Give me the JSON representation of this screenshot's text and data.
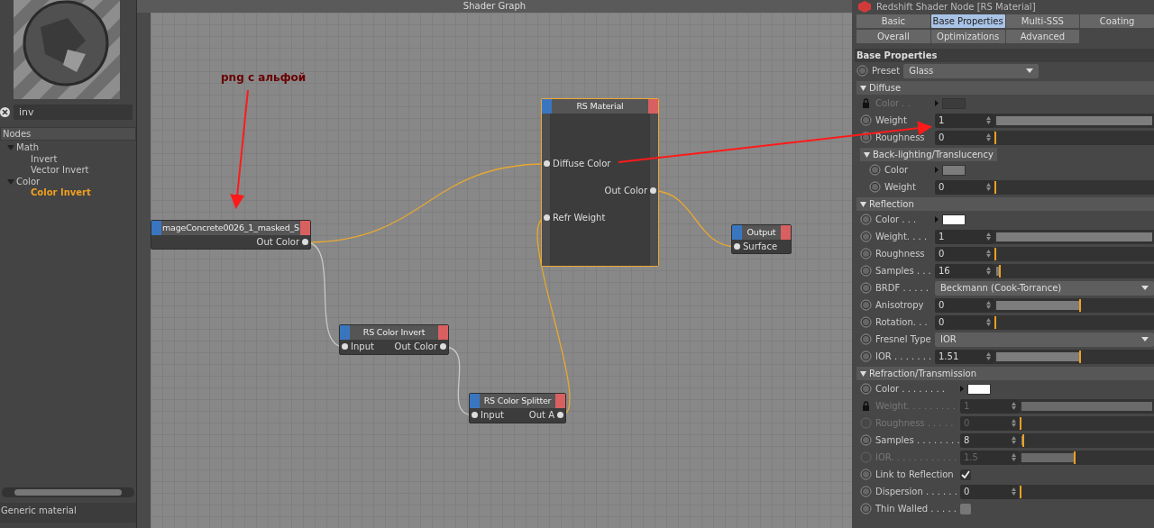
{
  "library": {
    "search": {
      "value": "inv"
    },
    "header": "Nodes",
    "tree": [
      {
        "label": "Math",
        "expanded": true,
        "selected": false,
        "children": [
          {
            "label": "Invert",
            "selected": false
          },
          {
            "label": "Vector Invert",
            "selected": false
          }
        ]
      },
      {
        "label": "Color",
        "expanded": true,
        "selected": false,
        "children": [
          {
            "label": "Color Invert",
            "selected": true
          }
        ]
      }
    ],
    "footer": "Generic material"
  },
  "graph": {
    "title": "Shader Graph",
    "nodes": [
      {
        "title": "mageConcrete0026_1_masked_S",
        "selected": false,
        "rows": [
          {
            "out": "Out Color"
          }
        ]
      },
      {
        "title": "RS Material",
        "selected": true,
        "rows": [
          {
            "in": "Diffuse Color"
          },
          {
            "out": "Out Color"
          },
          {
            "in": "Refr Weight"
          }
        ]
      },
      {
        "title": "Output",
        "selected": false,
        "rows": [
          {
            "in": "Surface"
          }
        ]
      },
      {
        "title": "RS Color Invert",
        "selected": false,
        "rows": [
          {
            "in": "Input",
            "out": "Out Color"
          }
        ]
      },
      {
        "title": "RS Color Splitter",
        "selected": false,
        "rows": [
          {
            "in": "Input",
            "out": "Out A"
          }
        ]
      }
    ],
    "wires": [
      {
        "active": true
      },
      {
        "active": true
      },
      {
        "active": false
      },
      {
        "active": false
      },
      {
        "active": true
      }
    ]
  },
  "annotation": {
    "label": "png с альфой"
  },
  "properties": {
    "title": "Redshift Shader Node [RS Material]",
    "tabs": [
      [
        {
          "label": "Basic",
          "selected": false
        },
        {
          "label": "Base Properties",
          "selected": true
        },
        {
          "label": "Multi-SSS",
          "selected": false
        },
        {
          "label": "Coating",
          "selected": false
        }
      ],
      [
        {
          "label": "Overall",
          "selected": false
        },
        {
          "label": "Optimizations",
          "selected": false
        },
        {
          "label": "Advanced",
          "selected": false
        }
      ]
    ],
    "heading": "Base Properties",
    "preset": {
      "label": "Preset",
      "value": "Glass"
    },
    "sections": [
      {
        "title": "Diffuse",
        "expanded": true,
        "rows": [
          {
            "kind": "color",
            "label": "Color . .",
            "locked": true,
            "disabled": true,
            "color": "#3c3c3c"
          },
          {
            "kind": "number",
            "label": "Weight",
            "value": "1",
            "level": 1,
            "disabled": false
          },
          {
            "kind": "number",
            "label": "Roughness",
            "value": "0",
            "level": 0,
            "disabled": false
          },
          {
            "kind": "group",
            "title": "Back-lighting/Translucency",
            "expanded": true,
            "rows": [
              {
                "kind": "color",
                "label": "Color",
                "color": "#7c7c7c",
                "disabled": false
              },
              {
                "kind": "number",
                "label": "Weight",
                "value": "0",
                "level": 0,
                "disabled": false
              }
            ]
          }
        ]
      },
      {
        "title": "Reflection",
        "expanded": true,
        "rows": [
          {
            "kind": "color",
            "label": "Color . . .",
            "color": "#ffffff",
            "disabled": false
          },
          {
            "kind": "number",
            "label": "Weight. . . .",
            "value": "1",
            "level": 1,
            "disabled": false
          },
          {
            "kind": "number",
            "label": "Roughness",
            "value": "0",
            "level": 0,
            "disabled": false
          },
          {
            "kind": "number",
            "label": "Samples . . .",
            "value": "16",
            "level": 0.03,
            "disabled": false
          },
          {
            "kind": "dropdown",
            "label": "BRDF . . . . .",
            "value": "Beckmann (Cook-Torrance)"
          },
          {
            "kind": "number",
            "label": "Anisotropy",
            "value": "0",
            "level": 0.53,
            "disabled": false
          },
          {
            "kind": "number",
            "label": "Rotation. . .",
            "value": "0",
            "level": 0,
            "disabled": false
          },
          {
            "kind": "dropdown",
            "label": "Fresnel Type",
            "value": "IOR"
          },
          {
            "kind": "number",
            "label": "IOR . . . . . . .",
            "value": "1.51",
            "level": 0.53,
            "disabled": false
          }
        ]
      },
      {
        "title": "Refraction/Transmission",
        "expanded": true,
        "rows": [
          {
            "kind": "color",
            "label": "Color . . . . . . . .",
            "color": "#ffffff",
            "disabled": false
          },
          {
            "kind": "number",
            "label": "Weight. . . . . . . . .",
            "value": "1",
            "level": 1,
            "locked": true,
            "disabled": true
          },
          {
            "kind": "number",
            "label": "Roughness . . . . .",
            "value": "0",
            "level": 0,
            "disabled": true
          },
          {
            "kind": "number",
            "label": "Samples . . . . . . . .",
            "value": "8",
            "level": 0.02,
            "disabled": false
          },
          {
            "kind": "number",
            "label": "IOR. . . . . . . . . . . .",
            "value": "1.5",
            "level": 0.4,
            "disabled": true
          },
          {
            "kind": "checkbox",
            "label": "Link to Reflection",
            "checked": true
          },
          {
            "kind": "number",
            "label": "Dispersion . . . . . .",
            "value": "0",
            "level": 0,
            "disabled": false
          },
          {
            "kind": "checkbox",
            "label": "Thin Walled . . . . .",
            "checked": false
          }
        ]
      }
    ]
  }
}
